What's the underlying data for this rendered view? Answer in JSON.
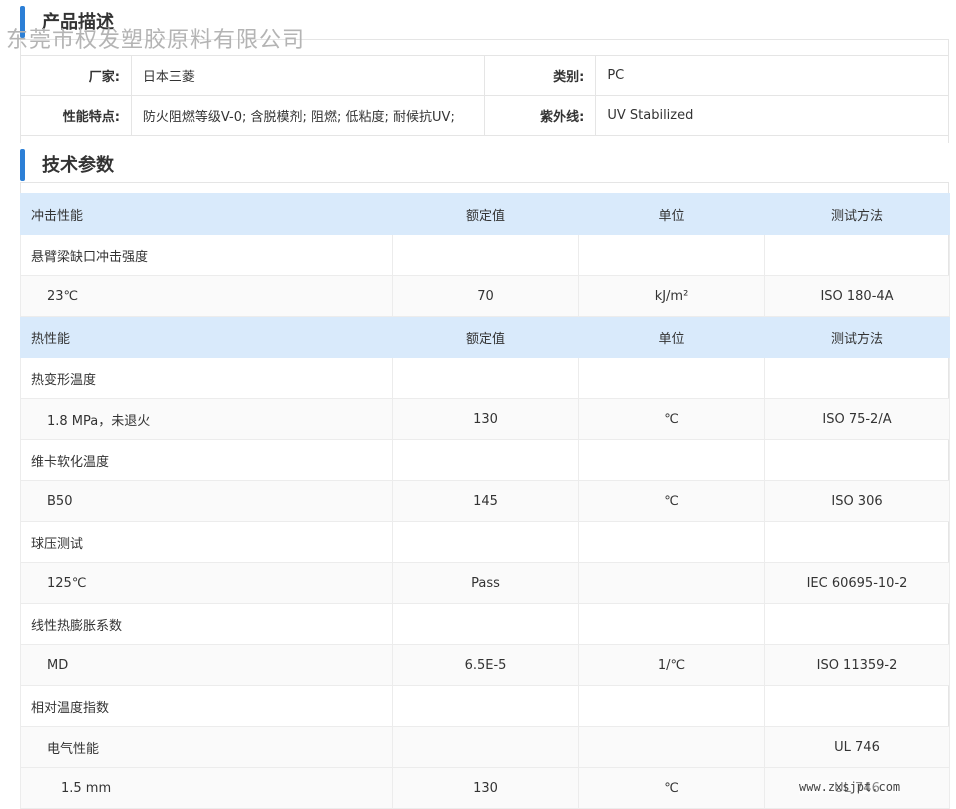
{
  "watermark": "东莞市权发塑胶原料有限公司",
  "site_mark": "www.zxsjpt.com",
  "accent_color": "#2c7fd6",
  "header_row_color": "#d9eafb",
  "description": {
    "title": "产品描述",
    "rows": [
      {
        "label1": "厂家:",
        "value1": "日本三菱",
        "label2": "类别:",
        "value2": "PC"
      },
      {
        "label1": "性能特点:",
        "value1": "防火阻燃等级V-0; 含脱模剂; 阻燃; 低粘度; 耐候抗UV;",
        "label2": "紫外线:",
        "value2": "UV Stabilized"
      }
    ]
  },
  "specs": {
    "title": "技术参数",
    "rows": [
      {
        "type": "head",
        "name": "冲击性能",
        "value": "额定值",
        "unit": "单位",
        "method": "测试方法"
      },
      {
        "type": "group",
        "name": "悬臂梁缺口冲击强度",
        "value": "",
        "unit": "",
        "method": ""
      },
      {
        "type": "item",
        "name": "23℃",
        "value": "70",
        "unit": "kJ/m²",
        "method": "ISO 180-4A"
      },
      {
        "type": "head",
        "name": "热性能",
        "value": "额定值",
        "unit": "单位",
        "method": "测试方法"
      },
      {
        "type": "group",
        "name": "热变形温度",
        "value": "",
        "unit": "",
        "method": ""
      },
      {
        "type": "item",
        "name": "1.8 MPa，未退火",
        "value": "130",
        "unit": "℃",
        "method": "ISO 75-2/A"
      },
      {
        "type": "group",
        "name": "维卡软化温度",
        "value": "",
        "unit": "",
        "method": ""
      },
      {
        "type": "item",
        "name": "B50",
        "value": "145",
        "unit": "℃",
        "method": "ISO 306"
      },
      {
        "type": "group",
        "name": "球压测试",
        "value": "",
        "unit": "",
        "method": ""
      },
      {
        "type": "item",
        "name": "125℃",
        "value": "Pass",
        "unit": "",
        "method": "IEC 60695-10-2"
      },
      {
        "type": "group",
        "name": "线性热膨胀系数",
        "value": "",
        "unit": "",
        "method": ""
      },
      {
        "type": "item",
        "name": "MD",
        "value": "6.5E-5",
        "unit": "1/℃",
        "method": "ISO 11359-2"
      },
      {
        "type": "group",
        "name": "相对温度指数",
        "value": "",
        "unit": "",
        "method": ""
      },
      {
        "type": "item",
        "name": "电气性能",
        "value": "",
        "unit": "",
        "method": "UL 746"
      },
      {
        "type": "subitem",
        "name": "1.5 mm",
        "value": "130",
        "unit": "℃",
        "method": "UL 746"
      }
    ]
  }
}
